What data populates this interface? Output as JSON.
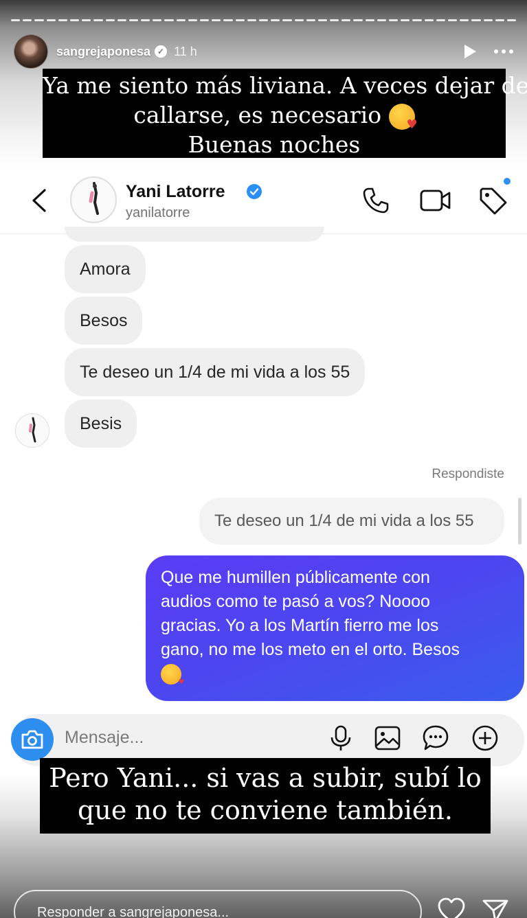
{
  "story": {
    "username": "sangrejaponesa",
    "time_ago": "11 h",
    "caption_top": [
      "Ya me siento más liviana. A veces dejar de",
      "callarse, es necesario",
      "Buenas noches"
    ],
    "caption_bottom": [
      "Pero Yani... si vas a subir, subí lo",
      "que no te conviene también."
    ],
    "reply_placeholder": "Responder a sangrejaponesa..."
  },
  "dm": {
    "name": "Yani Latorre",
    "handle": "yanilatorre",
    "received_messages": [
      "Amora",
      "Besos",
      "Te deseo un 1/4 de mi vida a los 55",
      "Besis"
    ],
    "replied_label": "Respondiste",
    "quoted_message": "Te deseo un 1/4 de mi vida a los 55",
    "sent_message_lines": [
      "Que me humillen públicamente con",
      "audios como te pasó a vos? Noooo",
      "gracias. Yo a los Martín fierro me los",
      "gano, no me los meto en el orto. Besos"
    ],
    "composer_placeholder": "Mensaje..."
  },
  "colors": {
    "sent_bubble": "#4d45f0",
    "received_bubble": "#efefef",
    "accent_blue": "#2d8ef0"
  },
  "icons": [
    "play-icon",
    "more-icon",
    "back-icon",
    "verified-icon",
    "call-icon",
    "video-icon",
    "tag-icon",
    "camera-icon",
    "mic-icon",
    "gallery-icon",
    "sticker-icon",
    "plus-icon",
    "heart-icon",
    "send-icon",
    "kiss-emoji"
  ]
}
